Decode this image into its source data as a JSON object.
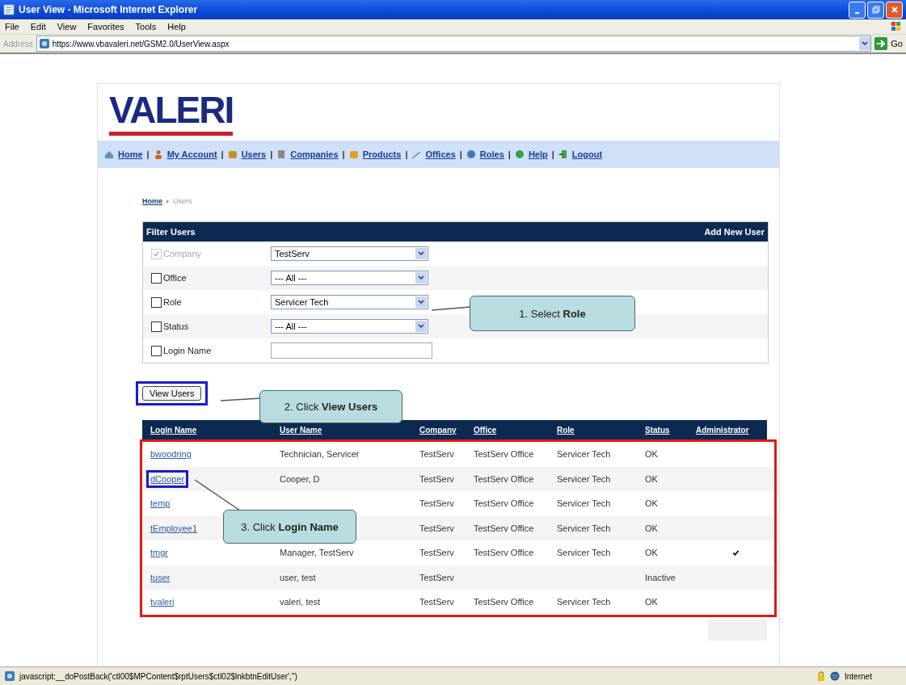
{
  "window": {
    "title": "User View - Microsoft Internet Explorer"
  },
  "menu": [
    "File",
    "Edit",
    "View",
    "Favorites",
    "Tools",
    "Help"
  ],
  "address": {
    "label": "Address",
    "url": "https://www.vbavaleri.net/GSM2.0/UserView.aspx",
    "go": "Go"
  },
  "logo": {
    "text": "VALERI"
  },
  "nav": {
    "separator": "|",
    "items": [
      {
        "label": "Home"
      },
      {
        "label": "My Account"
      },
      {
        "label": "Users"
      },
      {
        "label": "Companies"
      },
      {
        "label": "Products"
      },
      {
        "label": "Offices"
      },
      {
        "label": "Roles"
      },
      {
        "label": "Help"
      },
      {
        "label": "Logout"
      }
    ]
  },
  "breadcrumb": {
    "home": "Home",
    "current": "Users"
  },
  "filter": {
    "title": "Filter Users",
    "action": "Add New User",
    "rows": [
      {
        "label": "Company",
        "checked": true,
        "disabled": true,
        "kind": "select",
        "value": "TestServ"
      },
      {
        "label": "Office",
        "checked": false,
        "disabled": false,
        "kind": "select",
        "value": "--- All ---"
      },
      {
        "label": "Role",
        "checked": false,
        "disabled": false,
        "kind": "select",
        "value": "Servicer Tech"
      },
      {
        "label": "Status",
        "checked": false,
        "disabled": false,
        "kind": "select",
        "value": "--- All ---"
      },
      {
        "label": "Login Name",
        "checked": false,
        "disabled": false,
        "kind": "text"
      }
    ]
  },
  "view_button": {
    "label": "View Users",
    "highlighted": true
  },
  "table": {
    "columns": [
      "Login Name",
      "User Name",
      "Company",
      "Office",
      "Role",
      "Status",
      "Administrator"
    ],
    "rows": [
      {
        "login": "bwoodring",
        "user_name": "Technician, Servicer",
        "company": "TestServ",
        "office": "TestServ Office",
        "role": "Servicer Tech",
        "status": "OK",
        "administrator": false,
        "highlighted": false
      },
      {
        "login": "dCooper",
        "user_name": "Cooper, D",
        "company": "TestServ",
        "office": "TestServ Office",
        "role": "Servicer Tech",
        "status": "OK",
        "administrator": false,
        "highlighted": true
      },
      {
        "login": "temp",
        "company": "TestServ",
        "office": "TestServ Office",
        "role": "Servicer Tech",
        "status": "OK",
        "administrator": false,
        "highlighted": false
      },
      {
        "login": "tEmployee1",
        "company": "TestServ",
        "office": "TestServ Office",
        "role": "Servicer Tech",
        "status": "OK",
        "administrator": false,
        "highlighted": false
      },
      {
        "login": "tmgr",
        "user_name": "Manager, TestServ",
        "company": "TestServ",
        "office": "TestServ Office",
        "role": "Servicer Tech",
        "status": "OK",
        "administrator": true,
        "highlighted": false
      },
      {
        "login": "tuser",
        "user_name": "user, test",
        "company": "TestServ",
        "status": "Inactive",
        "administrator": false,
        "highlighted": false
      },
      {
        "login": "tvaleri",
        "user_name": "valeri, test",
        "company": "TestServ",
        "office": "TestServ Office",
        "role": "Servicer Tech",
        "status": "OK",
        "administrator": false,
        "highlighted": false
      }
    ]
  },
  "callouts": [
    "1. Select **Role**",
    "2. Click **View Users**",
    "3. Click **Login Name**"
  ],
  "status_bar": {
    "text": "javascript:__doPostBack('ctl00$MPContent$rptUsers$ctl02$lnkbtnEditUser','')",
    "zone": "Internet"
  }
}
